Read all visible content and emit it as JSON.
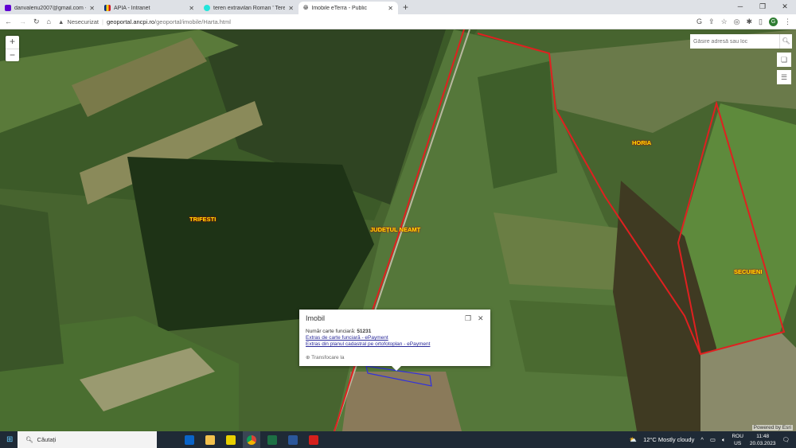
{
  "browser": {
    "tabs": [
      {
        "title": "danvaleriu2007@gmail.com - Yah",
        "favicon": "mail-icon",
        "color": "#6001d2"
      },
      {
        "title": "APIA - Intranet",
        "favicon": "flag-icon",
        "color": "#002b7f"
      },
      {
        "title": "teren extravilan Roman ' Terenuri",
        "favicon": "olx-icon",
        "color": "#23e5db"
      },
      {
        "title": "Imobile eTerra - Public",
        "favicon": "globe-icon",
        "color": "#555555",
        "active": true
      }
    ],
    "security": "Nesecurizat",
    "url_host": "geoportal.ancpi.ro",
    "url_path": "/geoportal/imobile/Harta.html",
    "profile_initial": "G"
  },
  "map": {
    "search_placeholder": "Găsire adresă sau loc",
    "zoom_in": "+",
    "zoom_out": "−",
    "labels": {
      "trifesti": "TRIFESTI",
      "judet": "JUDEȚUL NEAMȚ",
      "horia": "HORIA",
      "secuieni": "SECUIENI"
    },
    "attribution": "Powered by Esri",
    "boundary_color": "#e02020",
    "popup": {
      "title": "Imobil",
      "cf_label": "Număr carte funciară: ",
      "cf_value": "51231",
      "link1": "Extras de carte funciară - ePayment",
      "link2": "Extras din planul cadastral pe ortofotoplan - ePayment",
      "zoom_to": "Transfocare la"
    }
  },
  "taskbar": {
    "search": "Căutați",
    "weather": "12°C  Mostly cloudy",
    "lang1": "ROU",
    "lang2": "US",
    "time": "11:48",
    "date": "20.03.2023"
  }
}
